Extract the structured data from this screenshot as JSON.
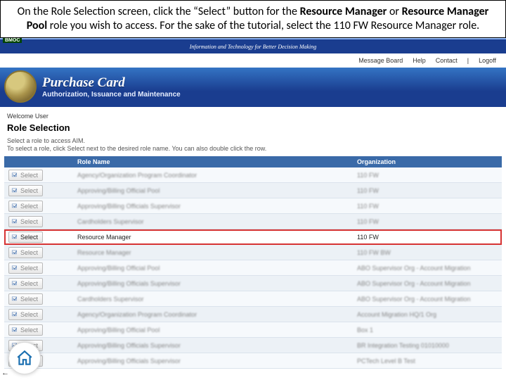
{
  "instruction": {
    "p1": "On the Role Selection screen, click the “Select” button for the ",
    "b1": "Resource Manager",
    "p2": " or ",
    "b2": "Resource Manager Pool",
    "p3": " role you wish to access.  For the sake of the tutorial, select the 110 FW Resource Manager role."
  },
  "topbar": {
    "tag": "BMOC",
    "text": "Information and Technology for Better Decision Making"
  },
  "nav": {
    "msg": "Message Board",
    "help": "Help",
    "contact": "Contact",
    "sep": "|",
    "logoff": "Logoff"
  },
  "header": {
    "title": "Purchase Card",
    "subtitle": "Authorization, Issuance and Maintenance"
  },
  "welcome": "Welcome User",
  "page_title": "Role Selection",
  "sub1": "Select a role to access AIM.",
  "sub2": "To select a role, click Select next to the desired role name. You can also double click the row.",
  "columns": {
    "c0": "",
    "c1": "Role Name",
    "c2": "Organization"
  },
  "select_label": "Select",
  "rows": [
    {
      "role": "Agency/Organization Program Coordinator",
      "org": "110 FW",
      "hl": false
    },
    {
      "role": "Approving/Billing Official Pool",
      "org": "110 FW",
      "hl": false
    },
    {
      "role": "Approving/Billing Officials Supervisor",
      "org": "110 FW",
      "hl": false
    },
    {
      "role": "Cardholders Supervisor",
      "org": "110 FW",
      "hl": false
    },
    {
      "role": "Resource Manager",
      "org": "110 FW",
      "hl": true
    },
    {
      "role": "Resource Manager",
      "org": "110 FW BW",
      "hl": false
    },
    {
      "role": "Approving/Billing Official Pool",
      "org": "ABO Supervisor Org - Account Migration",
      "hl": false
    },
    {
      "role": "Approving/Billing Officials Supervisor",
      "org": "ABO Supervisor Org - Account Migration",
      "hl": false
    },
    {
      "role": "Cardholders Supervisor",
      "org": "ABO Supervisor Org - Account Migration",
      "hl": false
    },
    {
      "role": "Agency/Organization Program Coordinator",
      "org": "Account Migration HQ/1 Org",
      "hl": false
    },
    {
      "role": "Approving/Billing Official Pool",
      "org": "Box 1",
      "hl": false
    },
    {
      "role": "Approving/Billing Officials Supervisor",
      "org": "BR Integration Testing 01010000",
      "hl": false
    },
    {
      "role": "Approving/Billing Officials Supervisor",
      "org": "PCTech Level B Test",
      "hl": false
    }
  ]
}
